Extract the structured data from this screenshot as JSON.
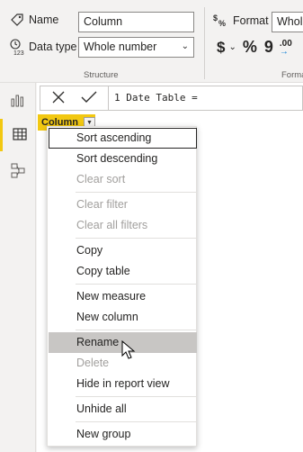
{
  "ribbon": {
    "name_label": "Name",
    "name_value": "Column",
    "datatype_label": "Data type",
    "datatype_value": "Whole number",
    "structure_caption": "Structure",
    "format_label": "Format",
    "format_value": "Whole",
    "currency_symbol": "$",
    "percent_symbol": "%",
    "comma_symbol": "9",
    "decimal_symbol": ".00",
    "format_caption": "Forma"
  },
  "formula_bar": {
    "formula_text": "1  Date Table ="
  },
  "column_header": {
    "label": "Column"
  },
  "context_menu": {
    "items": [
      {
        "label": "Sort ascending",
        "enabled": true
      },
      {
        "label": "Sort descending",
        "enabled": true
      },
      {
        "label": "Clear sort",
        "enabled": false
      },
      {
        "label": "Clear filter",
        "enabled": false
      },
      {
        "label": "Clear all filters",
        "enabled": false
      },
      {
        "label": "Copy",
        "enabled": true
      },
      {
        "label": "Copy table",
        "enabled": true
      },
      {
        "label": "New measure",
        "enabled": true
      },
      {
        "label": "New column",
        "enabled": true
      },
      {
        "label": "Rename",
        "enabled": true,
        "hovered": true
      },
      {
        "label": "Delete",
        "enabled": false
      },
      {
        "label": "Hide in report view",
        "enabled": true
      },
      {
        "label": "Unhide all",
        "enabled": true
      },
      {
        "label": "New group",
        "enabled": true
      }
    ]
  },
  "rail": {
    "icons": [
      "report-view-icon",
      "data-view-icon",
      "model-view-icon"
    ],
    "active": "data-view-icon"
  },
  "colors": {
    "accent": "#f2c811",
    "hover": "#c8c6c4",
    "disabled_text": "#a19f9d"
  }
}
